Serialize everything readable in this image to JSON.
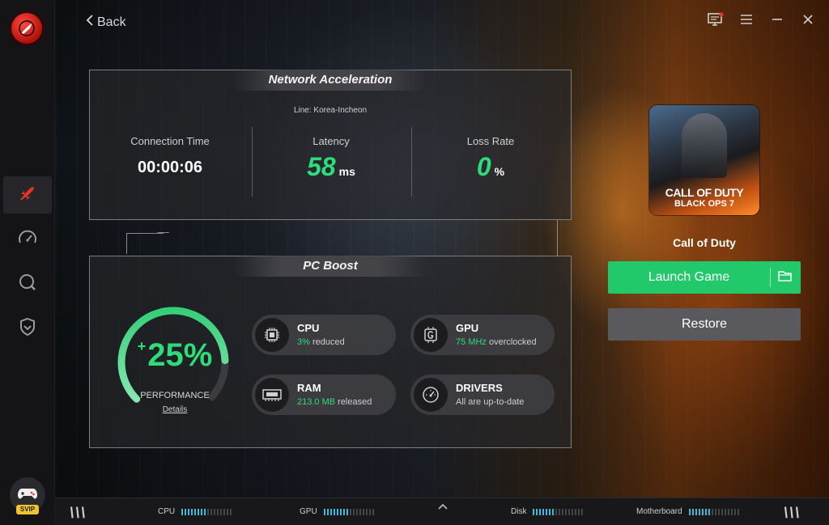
{
  "nav": {
    "back_label": "Back",
    "items": [
      "rocket-icon",
      "speedometer-icon",
      "search-icon",
      "shield-icon"
    ],
    "active_index": 0,
    "svip_label": "SVIP"
  },
  "network": {
    "title": "Network Acceleration",
    "line": "Line: Korea-Incheon",
    "connection_time_label": "Connection Time",
    "connection_time_value": "00:00:06",
    "latency_label": "Latency",
    "latency_value": "58",
    "latency_unit": "ms",
    "loss_rate_label": "Loss Rate",
    "loss_rate_value": "0",
    "loss_rate_unit": "%"
  },
  "pc_boost": {
    "title": "PC Boost",
    "performance_prefix": "+",
    "performance_value": "25%",
    "performance_fraction": 0.25,
    "performance_label": "PERFORMANCE",
    "details_label": "Details",
    "cpu_title": "CPU",
    "cpu_value": "3%",
    "cpu_suffix": "reduced",
    "gpu_title": "GPU",
    "gpu_value": "75 MHz",
    "gpu_suffix": "overclocked",
    "ram_title": "RAM",
    "ram_value": "213.0 MB",
    "ram_suffix": "released",
    "drivers_title": "DRIVERS",
    "drivers_status": "All are up-to-date"
  },
  "game": {
    "cover_line1": "CALL OF DUTY",
    "cover_line2": "BLACK OPS 7",
    "name": "Call of Duty",
    "launch_label": "Launch Game",
    "restore_label": "Restore"
  },
  "bottom": {
    "cpu_label": "CPU",
    "gpu_label": "GPU",
    "disk_label": "Disk",
    "motherboard_label": "Motherboard"
  },
  "colors": {
    "accent_green": "#2edc7a",
    "launch_green": "#22c96b",
    "meter_blue": "#3fb9d8"
  }
}
